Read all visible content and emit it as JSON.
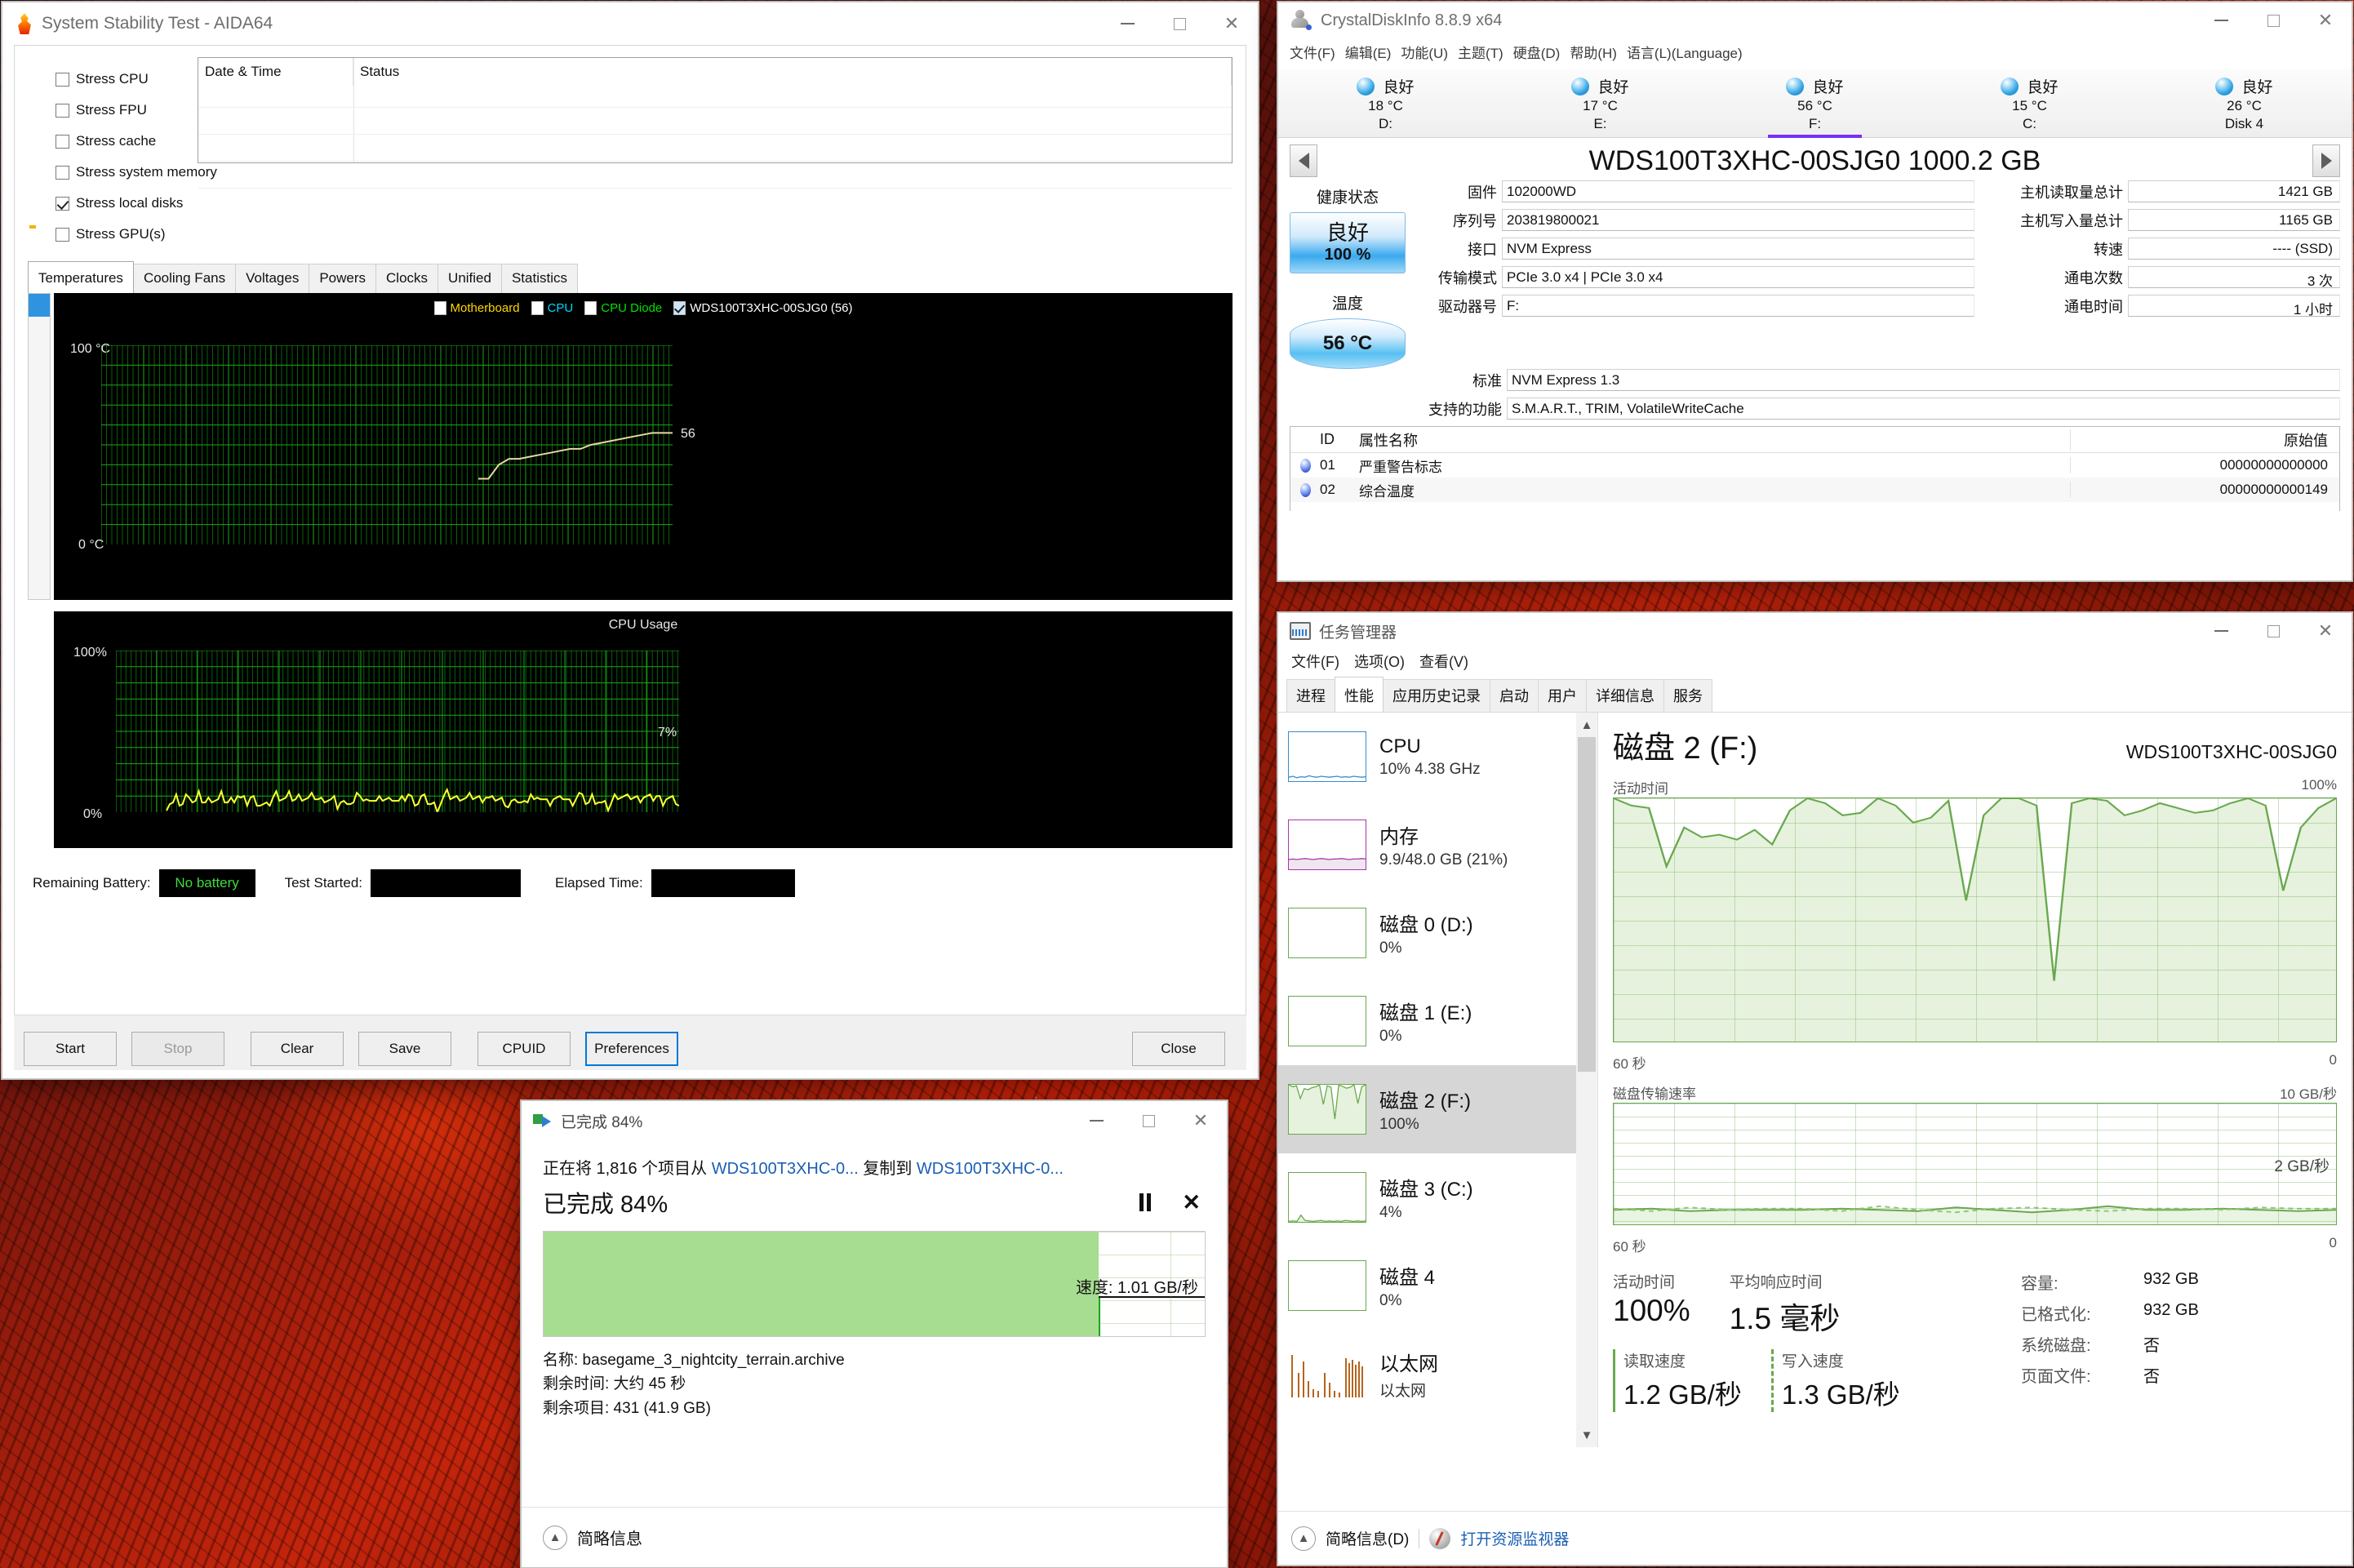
{
  "aida64": {
    "title": "System Stability Test - AIDA64",
    "title_icon": "flame-icon",
    "caption": {
      "minimize": "–",
      "maximize": "□",
      "close": "✕"
    },
    "stress_options": [
      {
        "label": "Stress CPU",
        "checked": false,
        "icon": "cpu-chip-icon"
      },
      {
        "label": "Stress FPU",
        "checked": false,
        "icon": "fpu-chip-icon"
      },
      {
        "label": "Stress cache",
        "checked": false,
        "icon": "cache-chip-icon"
      },
      {
        "label": "Stress system memory",
        "checked": false,
        "icon": "memory-module-icon"
      },
      {
        "label": "Stress local disks",
        "checked": true,
        "icon": "hard-disk-icon"
      },
      {
        "label": "Stress GPU(s)",
        "checked": false,
        "icon": "gpu-card-icon"
      }
    ],
    "log_columns": [
      "Date & Time",
      "Status"
    ],
    "log_rows": [],
    "tabs": [
      "Temperatures",
      "Cooling Fans",
      "Voltages",
      "Powers",
      "Clocks",
      "Unified",
      "Statistics"
    ],
    "active_tab": "Temperatures",
    "temperature_graph": {
      "legend": [
        {
          "label": "Motherboard",
          "checked": false,
          "color": "#ffd700"
        },
        {
          "label": "CPU",
          "checked": false,
          "color": "#00d7ff"
        },
        {
          "label": "CPU Diode",
          "checked": false,
          "color": "#00e000"
        },
        {
          "label": "WDS100T3XHC-00SJG0 (56)",
          "checked": true,
          "color": "#e8d8a0"
        }
      ],
      "y_top": "100 °C",
      "y_bottom": "0 °C",
      "current_label": "56"
    },
    "cpu_graph": {
      "title": "CPU Usage",
      "y_top": "100%",
      "y_bottom": "0%",
      "current_label": "7%"
    },
    "metrics": [
      {
        "label": "Remaining Battery:",
        "value": "No battery"
      },
      {
        "label": "Test Started:",
        "value": ""
      },
      {
        "label": "Elapsed Time:",
        "value": ""
      }
    ],
    "buttons": [
      {
        "label": "Start",
        "state": "enabled"
      },
      {
        "label": "Stop",
        "state": "disabled"
      },
      {
        "label": "Clear",
        "state": "enabled"
      },
      {
        "label": "Save",
        "state": "enabled"
      },
      {
        "label": "CPUID",
        "state": "enabled"
      },
      {
        "label": "Preferences",
        "state": "focused"
      },
      {
        "label": "Close",
        "state": "enabled"
      }
    ]
  },
  "crystaldiskinfo": {
    "title": "CrystalDiskInfo 8.8.9 x64",
    "menu": [
      "文件(F)",
      "编辑(E)",
      "功能(U)",
      "主题(T)",
      "硬盘(D)",
      "帮助(H)",
      "语言(L)(Language)"
    ],
    "drives": [
      {
        "status": "良好",
        "temp": "18 °C",
        "name": "D:",
        "selected": false
      },
      {
        "status": "良好",
        "temp": "17 °C",
        "name": "E:",
        "selected": false
      },
      {
        "status": "良好",
        "temp": "56 °C",
        "name": "F:",
        "selected": true
      },
      {
        "status": "良好",
        "temp": "15 °C",
        "name": "C:",
        "selected": false
      },
      {
        "status": "良好",
        "temp": "26 °C",
        "name": "Disk 4",
        "selected": false
      }
    ],
    "model": "WDS100T3XHC-00SJG0 1000.2 GB",
    "health_caption": "健康状态",
    "health_status": "良好",
    "health_percent": "100 %",
    "temp_caption": "温度",
    "temp_value": "56 °C",
    "fields_left": [
      {
        "label": "固件",
        "value": "102000WD"
      },
      {
        "label": "序列号",
        "value": "203819800021"
      },
      {
        "label": "接口",
        "value": "NVM Express"
      },
      {
        "label": "传输模式",
        "value": "PCIe 3.0 x4 | PCIe 3.0 x4"
      },
      {
        "label": "驱动器号",
        "value": "F:"
      }
    ],
    "fields_right": [
      {
        "label": "主机读取量总计",
        "value": "1421 GB"
      },
      {
        "label": "主机写入量总计",
        "value": "1165 GB"
      },
      {
        "label": "转速",
        "value": "---- (SSD)"
      },
      {
        "label": "通电次数",
        "value": "3 次"
      },
      {
        "label": "通电时间",
        "value": "1 小时"
      }
    ],
    "fields_wide": [
      {
        "label": "标准",
        "value": "NVM Express 1.3"
      },
      {
        "label": "支持的功能",
        "value": "S.M.A.R.T., TRIM, VolatileWriteCache"
      }
    ],
    "smart_columns": [
      "ID",
      "属性名称",
      "原始值"
    ],
    "smart_rows": [
      {
        "id": "01",
        "name": "严重警告标志",
        "raw": "00000000000000"
      },
      {
        "id": "02",
        "name": "综合温度",
        "raw": "00000000000149"
      }
    ]
  },
  "taskmanager": {
    "title": "任务管理器",
    "menu": [
      "文件(F)",
      "选项(O)",
      "查看(V)"
    ],
    "tabs": [
      "进程",
      "性能",
      "应用历史记录",
      "启动",
      "用户",
      "详细信息",
      "服务"
    ],
    "active_tab": "性能",
    "sidebar": [
      {
        "name": "CPU",
        "value": "10%  4.38 GHz",
        "color": "#3a8bc9",
        "selected": false
      },
      {
        "name": "内存",
        "value": "9.9/48.0 GB (21%)",
        "color": "#a737a7",
        "selected": false
      },
      {
        "name": "磁盘 0 (D:)",
        "value": "0%",
        "color": "#6aa84f",
        "selected": false
      },
      {
        "name": "磁盘 1 (E:)",
        "value": "0%",
        "color": "#6aa84f",
        "selected": false
      },
      {
        "name": "磁盘 2 (F:)",
        "value": "100%",
        "color": "#6aa84f",
        "selected": true
      },
      {
        "name": "磁盘 3 (C:)",
        "value": "4%",
        "color": "#6aa84f",
        "selected": false
      },
      {
        "name": "磁盘 4",
        "value": "0%",
        "color": "#6aa84f",
        "selected": false
      },
      {
        "name": "以太网",
        "value": "以太网",
        "color": "#b5651d",
        "selected": false
      }
    ],
    "detail": {
      "heading": "磁盘 2 (F:)",
      "model": "WDS100T3XHC-00SJG0",
      "chart1_label": "活动时间",
      "chart1_max": "100%",
      "chart1_x_left": "60 秒",
      "chart1_x_right": "0",
      "chart2_label": "磁盘传输速率",
      "chart2_max": "10 GB/秒",
      "chart2_inner": "2 GB/秒",
      "chart2_x_left": "60 秒",
      "chart2_x_right": "0",
      "stat_active_cap": "活动时间",
      "stat_active_val": "100%",
      "stat_resp_cap": "平均响应时间",
      "stat_resp_val": "1.5 毫秒",
      "stat_read_cap": "读取速度",
      "stat_read_val": "1.2 GB/秒",
      "stat_write_cap": "写入速度",
      "stat_write_val": "1.3 GB/秒",
      "info": [
        {
          "k": "容量:",
          "v": "932 GB"
        },
        {
          "k": "已格式化:",
          "v": "932 GB"
        },
        {
          "k": "系统磁盘:",
          "v": "否"
        },
        {
          "k": "页面文件:",
          "v": "否"
        }
      ]
    },
    "status": {
      "brief": "简略信息(D)",
      "resmon": "打开资源监视器"
    }
  },
  "copydialog": {
    "title": "已完成 84%",
    "line_prefix": "正在将 1,816 个项目从 ",
    "source": "WDS100T3XHC-0...",
    "line_mid": " 复制到 ",
    "destination": "WDS100T3XHC-0...",
    "percent_text": "已完成 84%",
    "percent_value": 84,
    "speed_label": "速度: 1.01 GB/秒",
    "name_line": "名称: basegame_3_nightcity_terrain.archive",
    "time_line": "剩余时间: 大约 45 秒",
    "items_line": "剩余项目: 431 (41.9 GB)",
    "footer": "简略信息",
    "pause_icon": "pause-icon",
    "cancel_icon": "cancel-icon"
  },
  "chart_data": [
    {
      "type": "line",
      "title": "AIDA64 Temperatures",
      "ylabel": "°C",
      "ylim": [
        0,
        100
      ],
      "grid": true,
      "series": [
        {
          "name": "WDS100T3XHC-00SJG0",
          "color": "#e8d8a0",
          "values": [
            33,
            33,
            40,
            43,
            43,
            44,
            45,
            46,
            47,
            48,
            48,
            50,
            51,
            52,
            53,
            54,
            55,
            56,
            56,
            56
          ]
        }
      ],
      "annotation": "56"
    },
    {
      "type": "line",
      "title": "CPU Usage",
      "ylabel": "%",
      "ylim": [
        0,
        100
      ],
      "grid": true,
      "series": [
        {
          "name": "CPU Usage",
          "color": "#ffff33",
          "values": [
            4,
            6,
            5,
            8,
            6,
            5,
            9,
            12,
            7,
            6,
            10,
            8,
            6,
            7,
            9,
            8,
            7,
            10,
            8,
            6,
            7,
            9,
            11,
            8,
            7,
            6,
            9,
            8,
            7,
            5,
            4,
            3,
            6,
            9,
            11,
            10,
            9,
            8,
            10,
            9,
            8,
            9,
            10,
            9,
            8,
            9,
            10,
            8,
            7,
            9,
            8,
            7,
            7
          ]
        }
      ],
      "annotation": "7%"
    },
    {
      "type": "area",
      "title": "活动时间",
      "ylim": [
        0,
        100
      ],
      "xlabel": "60 秒",
      "grid": true,
      "series": [
        {
          "name": "活动时间",
          "color": "#6aa84f",
          "values": [
            100,
            97,
            96,
            72,
            88,
            84,
            85,
            83,
            87,
            81,
            95,
            100,
            98,
            93,
            94,
            100,
            97,
            90,
            92,
            99,
            58,
            93,
            100,
            100,
            97,
            25,
            98,
            100,
            99,
            93,
            95,
            98,
            96,
            94,
            95,
            98,
            100,
            97,
            62,
            88,
            96,
            100
          ]
        }
      ]
    },
    {
      "type": "line",
      "title": "磁盘传输速率",
      "ylim": [
        0,
        10
      ],
      "ylabel": "GB/秒",
      "xlabel": "60 秒",
      "grid": true,
      "series": [
        {
          "name": "读取",
          "color": "#6aa84f",
          "values": [
            1.2,
            1.3,
            1.1,
            1.2,
            1.2,
            1.2,
            1.3,
            1.2,
            1.1,
            1.4,
            1.2,
            1.0,
            1.2,
            1.5,
            1.2,
            1.2,
            1.3,
            1.2,
            1.1,
            1.2
          ]
        },
        {
          "name": "写入",
          "color": "#8fc97a",
          "values": [
            1.3,
            1.1,
            1.4,
            1.2,
            1.3,
            1.3,
            1.1,
            1.5,
            1.2,
            1.0,
            1.3,
            1.4,
            1.2,
            1.1,
            1.3,
            1.3,
            1.2,
            1.4,
            1.3,
            1.3
          ]
        }
      ]
    },
    {
      "type": "area",
      "title": "Copy speed",
      "ylabel": "GB/秒",
      "series": [
        {
          "name": "速度",
          "color": "#22a game",
          "values": [
            1.45,
            1.2,
            1.05,
            1.18,
            1.0,
            0.95,
            1.1,
            0.98,
            1.22,
            1.0,
            0.92,
            1.08,
            0.95,
            1.3,
            1.0,
            0.9,
            1.12,
            1.0,
            0.95,
            1.25,
            1.02,
            0.9,
            1.08,
            1.0,
            1.15,
            1.0,
            0.95,
            1.3,
            1.05,
            1.01
          ]
        }
      ]
    }
  ]
}
